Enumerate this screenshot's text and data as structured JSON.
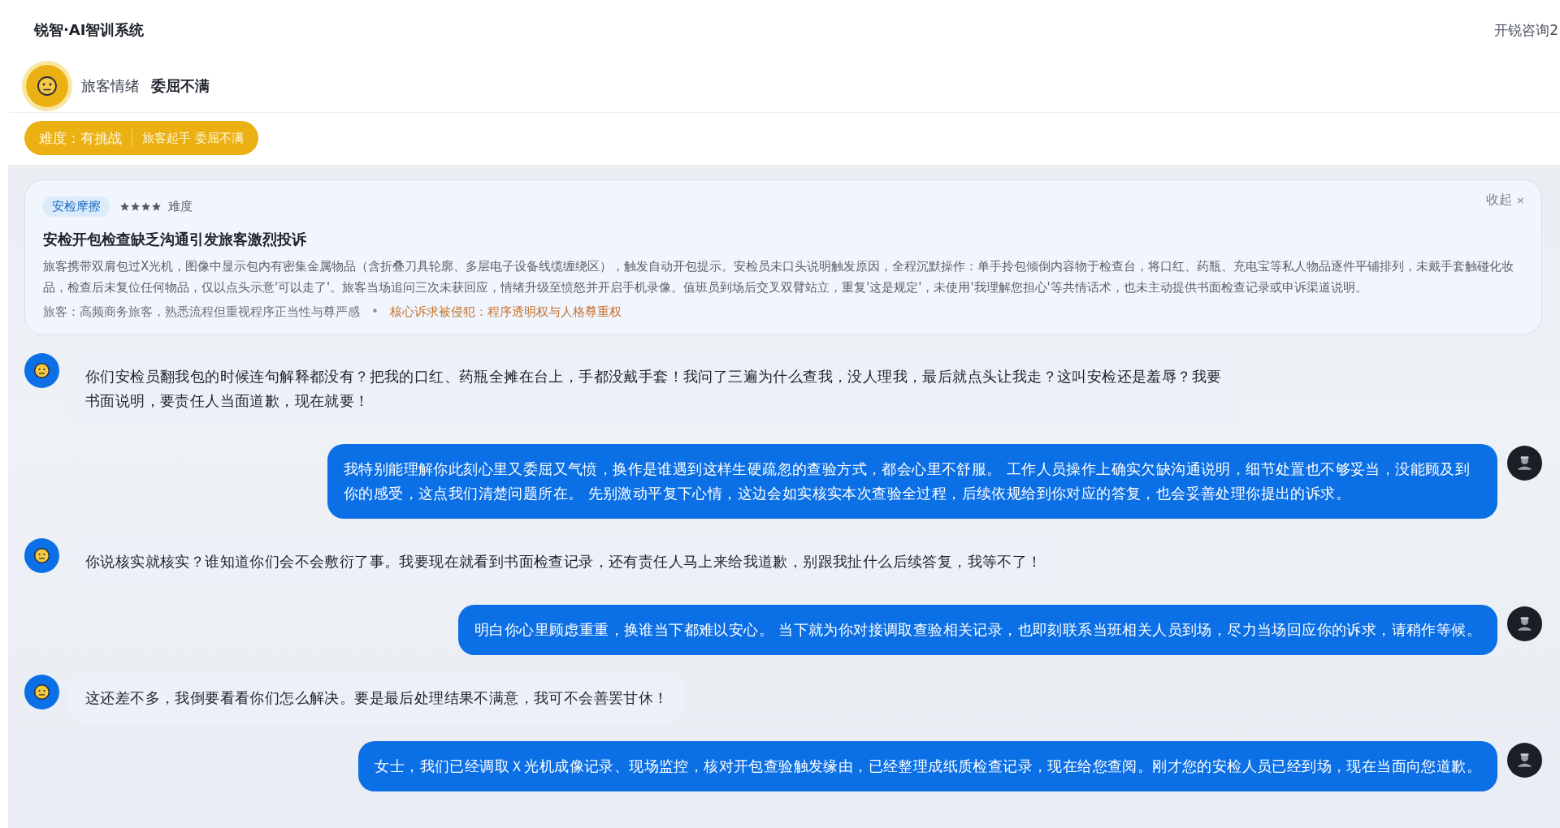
{
  "header": {
    "title": "锐智·AI智训系统",
    "user": "开锐咨询2"
  },
  "emotion": {
    "label": "旅客情绪",
    "value": "委屈不满"
  },
  "difficulty": {
    "label": "难度：有挑战",
    "detail": "旅客起手 委屈不满"
  },
  "scenario": {
    "tag": "安检摩擦",
    "stars": 4,
    "stars_label": "难度",
    "collapse": "收起",
    "close": "×",
    "title": "安检开包检查缺乏沟通引发旅客激烈投诉",
    "description": "旅客携带双肩包过X光机，图像中显示包内有密集金属物品（含折叠刀具轮廓、多层电子设备线缆缠绕区），触发自动开包提示。安检员未口头说明触发原因，全程沉默操作：单手拎包倾倒内容物于检查台，将口红、药瓶、充电宝等私人物品逐件平铺排列，未戴手套触碰化妆品，检查后未复位任何物品，仅以点头示意'可以走了'。旅客当场追问三次未获回应，情绪升级至愤怒并开启手机录像。值班员到场后交叉双臂站立，重复'这是规定'，未使用'我理解您担心'等共情话术，也未主动提供书面检查记录或申诉渠道说明。",
    "persona": "旅客：高频商务旅客，熟悉流程但重视程序正当性与尊严感",
    "separator": "•",
    "core_need": "核心诉求被侵犯：程序透明权与人格尊重权"
  },
  "messages": [
    {
      "kind": "traveler",
      "text": "你们安检员翻我包的时候连句解释都没有？把我的口红、药瓶全摊在台上，手都没戴手套！我问了三遍为什么查我，没人理我，最后就点头让我走？这叫安检还是羞辱？我要书面说明，要责任人当面道歉，现在就要！"
    },
    {
      "kind": "staff",
      "text": "我特别能理解你此刻心里又委屈又气愤，换作是谁遇到这样生硬疏忽的查验方式，都会心里不舒服。 工作人员操作上确实欠缺沟通说明，细节处置也不够妥当，没能顾及到你的感受，这点我们清楚问题所在。 先别激动平复下心情，这边会如实核实本次查验全过程，后续依规给到你对应的答复，也会妥善处理你提出的诉求。"
    },
    {
      "kind": "traveler",
      "text": "你说核实就核实？谁知道你们会不会敷衍了事。我要现在就看到书面检查记录，还有责任人马上来给我道歉，别跟我扯什么后续答复，我等不了！"
    },
    {
      "kind": "staff",
      "text": "明白你心里顾虑重重，换谁当下都难以安心。 当下就为你对接调取查验相关记录，也即刻联系当班相关人员到场，尽力当场回应你的诉求，请稍作等候。"
    },
    {
      "kind": "traveler",
      "text": "这还差不多，我倒要看看你们怎么解决。要是最后处理结果不满意，我可不会善罢甘休！"
    },
    {
      "kind": "staff",
      "text": "女士，我们已经调取Ｘ光机成像记录、现场监控，核对开包查验触发缘由，已经整理成纸质检查记录，现在给您查阅。刚才您的安检人员已经到场，现在当面向您道歉。"
    }
  ]
}
